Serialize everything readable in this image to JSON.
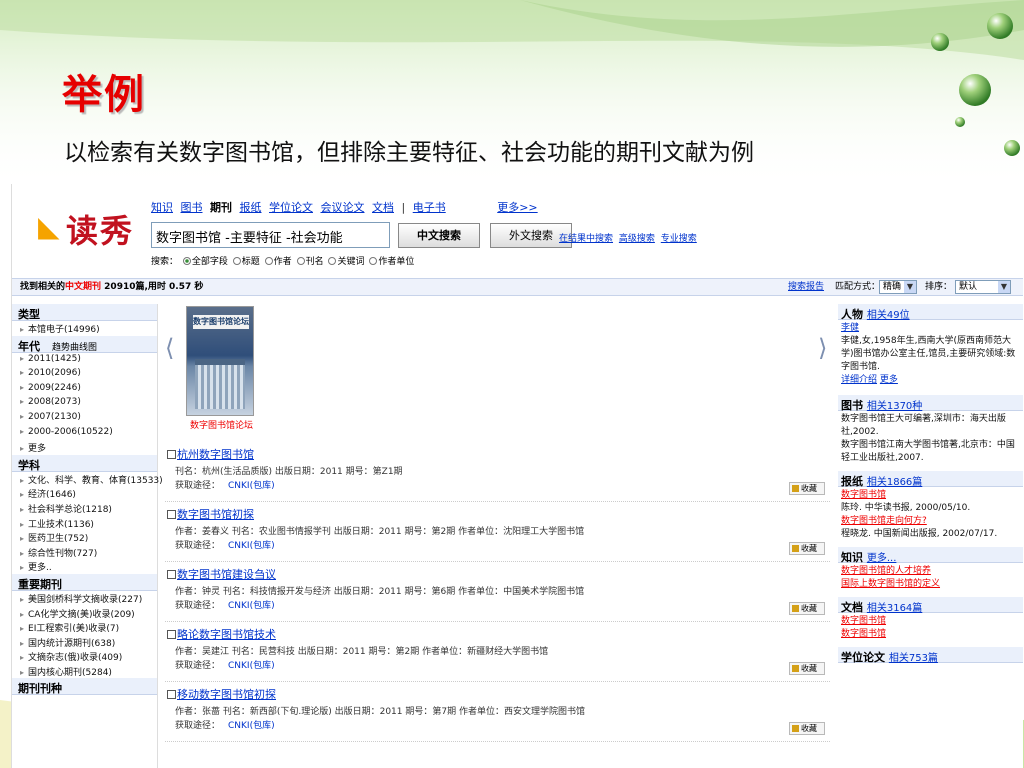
{
  "slide": {
    "title": "举例",
    "subtitle": "以检索有关数字图书馆，但排除主要特征、社会功能的期刊文献为例"
  },
  "header": {
    "logo_text": "读秀",
    "nav": [
      "知识",
      "图书",
      "期刊",
      "报纸",
      "学位论文",
      "会议论文",
      "文档",
      "|",
      "电子书",
      "更多>>"
    ],
    "search_value": "数字图书馆 -主要特征 -社会功能",
    "btn_cn": "中文搜索",
    "btn_foreign": "外文搜索",
    "adv_links": [
      "在结果中搜索",
      "高级搜索",
      "专业搜索"
    ],
    "field_label": "搜索：",
    "fields": [
      "全部字段",
      "标题",
      "作者",
      "刊名",
      "关键词",
      "作者单位"
    ]
  },
  "status": {
    "prefix": "找到相关的",
    "type_word": "中文期刊",
    "count": "20910",
    "suffix": "篇,用时",
    "time": "0.57 秒",
    "report": "搜索报告",
    "match_label": "匹配方式：",
    "match_value": "精确",
    "sort_label": "排序：",
    "sort_value": "默认"
  },
  "left": {
    "type_head": "类型",
    "type_items": [
      "本馆电子(14996)"
    ],
    "year_head": "年代",
    "year_link": "趋势曲线图",
    "year_items": [
      "2011(1425)",
      "2010(2096)",
      "2009(2246)",
      "2008(2073)",
      "2007(2130)",
      "2000-2006(10522)",
      "更多"
    ],
    "subject_head": "学科",
    "subject_items": [
      "文化、科学、教育、体育(13533)",
      "经济(1646)",
      "社会科学总论(1218)",
      "工业技术(1136)",
      "医药卫生(752)",
      "综合性刊物(727)",
      "更多.."
    ],
    "journal_head": "重要期刊",
    "journal_items": [
      "美国剑桥科学文摘收录(227)",
      "CA化学文摘(美)收录(209)",
      "EI工程索引(美)收录(7)",
      "国内统计源期刊(638)",
      "文摘杂志(俄)收录(409)",
      "国内核心期刊(5284)"
    ],
    "next_head": "期刊刊种"
  },
  "book": {
    "cover_title": "数字图书馆论坛",
    "caption": "数字图书馆论坛"
  },
  "results": [
    {
      "title": "杭州数字图书馆",
      "meta": "刊名：杭州(生活品质版) 出版日期：2011 期号：第Z1期",
      "source_label": "获取途径：",
      "source": "CNKI(包库)",
      "fav": "收藏"
    },
    {
      "title": "数字图书馆初探",
      "meta": "作者：姜春义 刊名：农业图书情报学刊 出版日期：2011 期号：第2期 作者单位：沈阳理工大学图书馆",
      "source_label": "获取途径：",
      "source": "CNKI(包库)",
      "fav": "收藏"
    },
    {
      "title": "数字图书馆建设刍议",
      "meta": "作者：钟灵 刊名：科技情报开发与经济 出版日期：2011 期号：第6期 作者单位：中国美术学院图书馆",
      "source_label": "获取途径：",
      "source": "CNKI(包库)",
      "fav": "收藏"
    },
    {
      "title": "略论数字图书馆技术",
      "meta": "作者：吴建江 刊名：民营科技 出版日期：2011 期号：第2期 作者单位：新疆财经大学图书馆",
      "source_label": "获取途径：",
      "source": "CNKI(包库)",
      "fav": "收藏"
    },
    {
      "title": "移动数字图书馆初探",
      "meta": "作者：张蔷 刊名：新西部(下旬.理论版) 出版日期：2011 期号：第7期 作者单位：西安文理学院图书馆",
      "source_label": "获取途径：",
      "source": "CNKI(包库)",
      "fav": "收藏"
    }
  ],
  "right": {
    "person_head": "人物",
    "person_count": "相关49位",
    "person_name": "李健",
    "person_desc": "李健,女,1958年生,西南大学(原西南师范大学)图书馆办公室主任,馆员,主要研究领域:数字图书馆.",
    "person_more1": "详细介绍",
    "person_more2": "更多",
    "book_head": "图书",
    "book_count": "相关1370种",
    "book1": "数字图书馆王大可编著,深圳市：海天出版社,2002.",
    "book2": "数字图书馆江南大学图书馆著,北京市：中国轻工业出版社,2007.",
    "paper_head": "报纸",
    "paper_count": "相关1866篇",
    "paper1_title": "数字图书馆",
    "paper1_meta": "陈玲. 中华读书报, 2000/05/10.",
    "paper2_title": "数字图书馆走向何方?",
    "paper2_meta": "程晓龙. 中国新闻出版报, 2002/07/17.",
    "know_head": "知识",
    "know_more": "更多...",
    "know1": "数字图书馆的人才培养",
    "know2": "国际上数字图书馆的定义",
    "doc_head": "文档",
    "doc_count": "相关3164篇",
    "doc1": "数字图书馆",
    "doc2": "数字图书馆",
    "thesis_head": "学位论文",
    "thesis_count": "相关753篇"
  },
  "colors": {
    "accent_red": "#e60000",
    "link_blue": "#0033cc",
    "header_bg": "#eaf0fb"
  }
}
